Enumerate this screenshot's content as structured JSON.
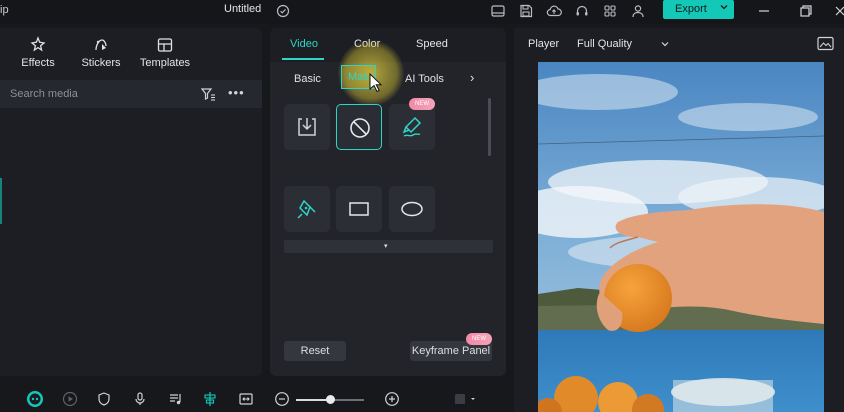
{
  "titlebar": {
    "app_fragment": "ip",
    "title": "Untitled",
    "export_label": "Export"
  },
  "left_panel": {
    "tabs": [
      {
        "label": "Effects",
        "icon": "effects-icon"
      },
      {
        "label": "Stickers",
        "icon": "stickers-icon"
      },
      {
        "label": "Templates",
        "icon": "templates-icon"
      }
    ],
    "search": {
      "placeholder": "Search media",
      "value": ""
    },
    "more_label": "•••"
  },
  "property_panel": {
    "tabs": [
      "Video",
      "Color",
      "Speed"
    ],
    "active_tab": "Video",
    "sub_tabs": [
      "Basic",
      "Mask",
      "AI Tools"
    ],
    "active_sub_tab": "Mask",
    "visible_sub_tab_text": "Mas",
    "mask_tiles": [
      {
        "name": "import-mask",
        "icon": "import-icon"
      },
      {
        "name": "none-mask",
        "icon": "none-icon",
        "selected": true
      },
      {
        "name": "draw-mask",
        "icon": "brush-icon",
        "badge": "NEW"
      },
      {
        "name": "pen-mask",
        "icon": "pen-icon"
      },
      {
        "name": "rectangle-mask",
        "icon": "rectangle-icon"
      },
      {
        "name": "ellipse-mask",
        "icon": "ellipse-icon"
      }
    ],
    "expand_arrow": "▾",
    "next_arrow": "›",
    "reset_label": "Reset",
    "keyframe_label": "Keyframe Panel",
    "keyframe_badge": "NEW"
  },
  "player": {
    "label": "Player",
    "quality": "Full Quality"
  },
  "bottom_toolbar": {
    "zoom_level": 0.5
  },
  "colors": {
    "accent": "#14c8b8",
    "accent_text": "#2fd5c6",
    "badge": "#f08aa8",
    "panel": "#1c1e23",
    "background": "#17181c"
  }
}
